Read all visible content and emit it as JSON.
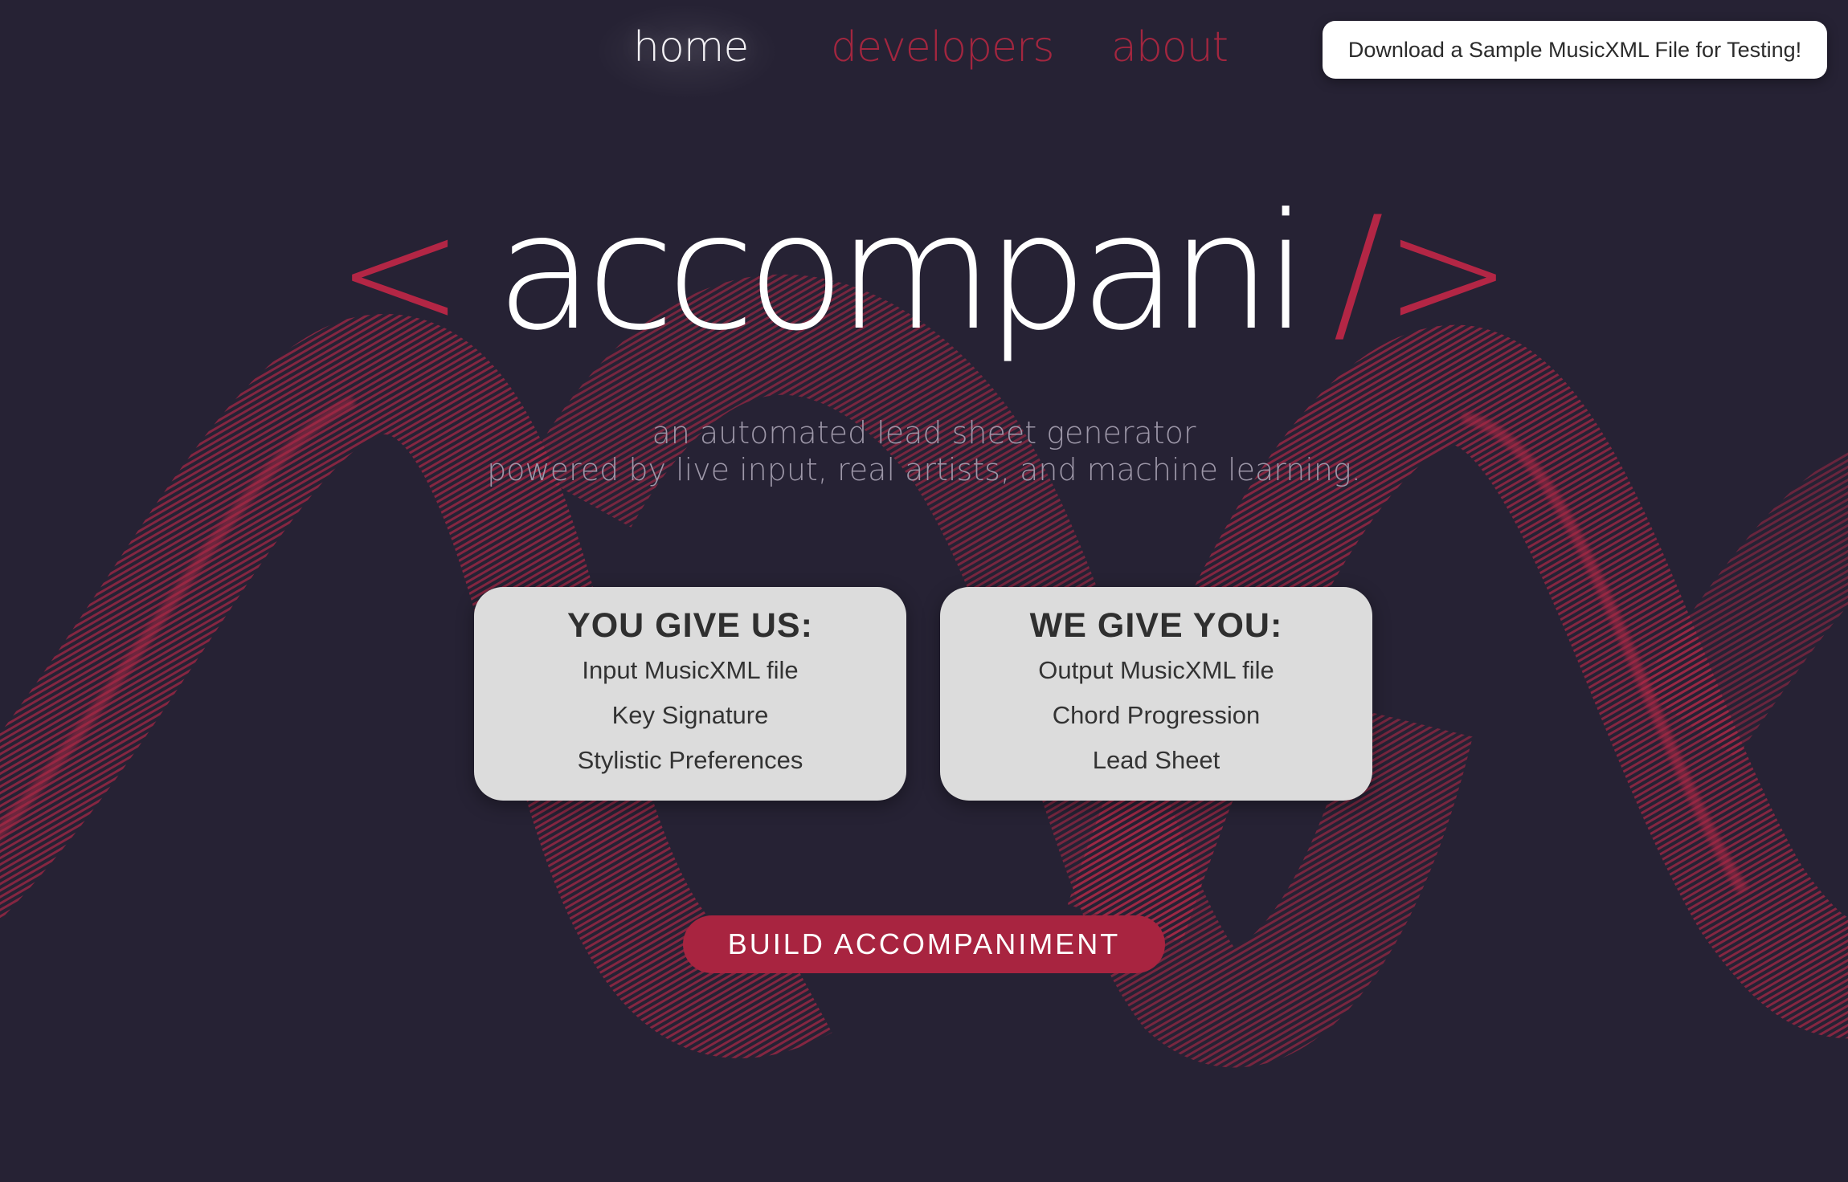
{
  "nav": {
    "items": [
      {
        "label": "home",
        "active": true
      },
      {
        "label": "developers",
        "active": false
      },
      {
        "label": "about",
        "active": false
      }
    ],
    "download_label": "Download a Sample MusicXML File for Testing!"
  },
  "hero": {
    "open_bracket": "<",
    "title": "accompani",
    "close_bracket": "/>",
    "subtitle_line1": "an automated lead sheet generator",
    "subtitle_line2": "powered by live input, real artists, and machine learning."
  },
  "cards": [
    {
      "title": "YOU GIVE US:",
      "items": [
        "Input MusicXML file",
        "Key Signature",
        "Stylistic Preferences"
      ]
    },
    {
      "title": "WE GIVE YOU:",
      "items": [
        "Output MusicXML file",
        "Chord Progression",
        "Lead Sheet"
      ]
    }
  ],
  "cta": {
    "label": "BUILD ACCOMPANIMENT"
  },
  "colors": {
    "background": "#262234",
    "accent": "#a82440",
    "wave": "#c42a4a",
    "card": "#dcdcdc"
  }
}
